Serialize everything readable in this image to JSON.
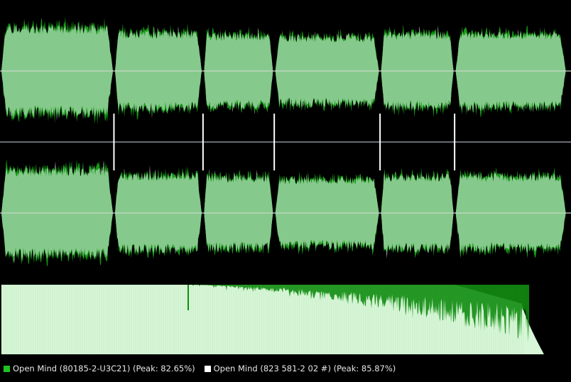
{
  "colors": {
    "background": "#000000",
    "waveform_light": "#86c98c",
    "waveform_dark": "#169a16",
    "waveform_grey": "#b8b0b8",
    "centerline": "#c8d8c8",
    "divider": "#8a8f9a",
    "track_marker": "#ffffff",
    "spectrum_fill": "#d8f7d8",
    "spectrum_line": "#9bd69b",
    "spectrum_overlay": "#118c11"
  },
  "waveforms": {
    "track_count": 6,
    "track_relative_widths": [
      1.0,
      0.78,
      0.62,
      0.93,
      0.65,
      0.99
    ],
    "track_loudness": [
      0.82,
      0.72,
      0.68,
      0.64,
      0.7,
      0.7
    ],
    "channel_names": [
      "left",
      "right"
    ]
  },
  "spectrum": {
    "description_icon": "frequency-spectrum-area"
  },
  "legend": [
    {
      "label": "Open Mind (80185-2-U3C21) (Peak: 82.65%)",
      "color": "#1fc41f"
    },
    {
      "label": "Open Mind (823 581-2 02 #) (Peak: 85.87%)",
      "color": "#ffffff"
    }
  ]
}
